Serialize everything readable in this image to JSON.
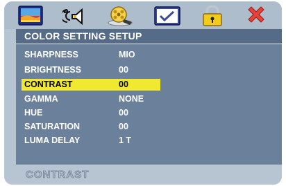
{
  "icons": [
    {
      "name": "picture-setting-icon",
      "selected": false
    },
    {
      "name": "audio-speaker-icon",
      "selected": false
    },
    {
      "name": "video-reel-icon",
      "selected": true
    },
    {
      "name": "preference-check-icon",
      "selected": false
    },
    {
      "name": "lock-icon",
      "selected": false
    },
    {
      "name": "exit-x-icon",
      "selected": false
    }
  ],
  "menu": {
    "title": "COLOR SETTING SETUP",
    "items": [
      {
        "label": "SHARPNESS",
        "value": "MIO",
        "selected": false
      },
      {
        "label": "BRIGHTNESS",
        "value": "00",
        "selected": false
      },
      {
        "label": "CONTRAST",
        "value": "00",
        "selected": true
      },
      {
        "label": "GAMMA",
        "value": "NONE",
        "selected": false
      },
      {
        "label": "HUE",
        "value": "00",
        "selected": false
      },
      {
        "label": "SATURATION",
        "value": "00",
        "selected": false
      },
      {
        "label": "LUMA DELAY",
        "value": "1 T",
        "selected": false
      }
    ]
  },
  "status": {
    "text": "CONTRAST"
  },
  "colors": {
    "frame": "#b7c4d1",
    "menu_background": "#6b809b",
    "header_background": "#566b88",
    "highlight": "#f1e92f",
    "text": "#ffffff"
  }
}
